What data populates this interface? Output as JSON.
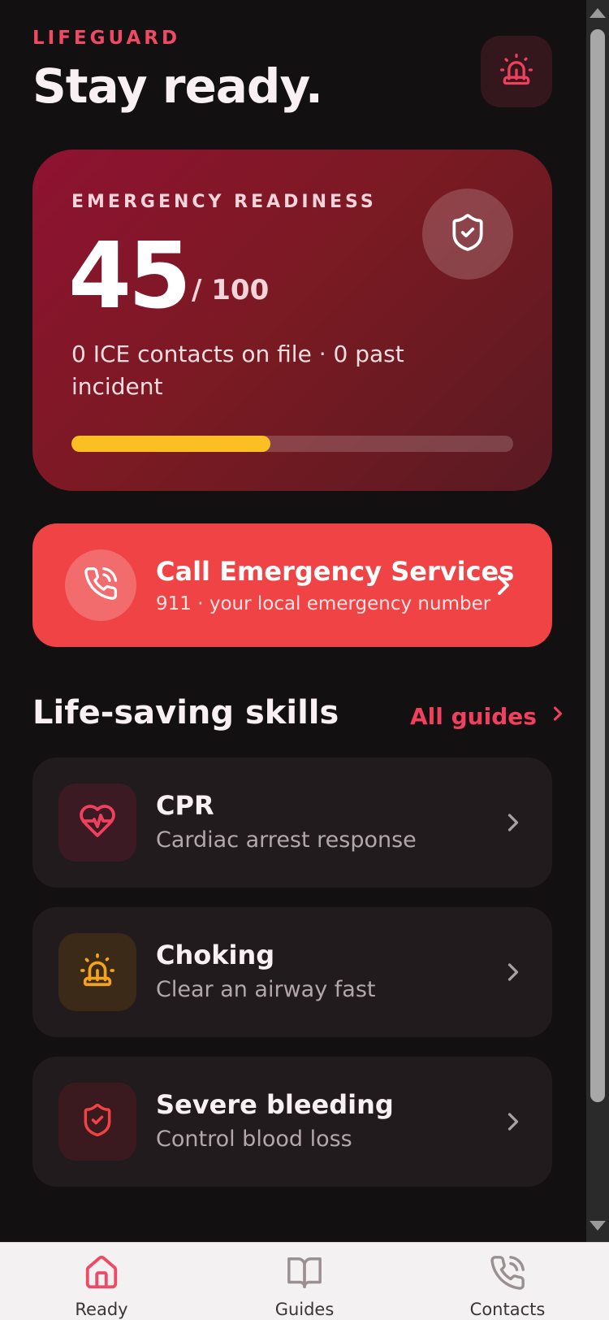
{
  "header": {
    "brand": "LIFEGUARD",
    "headline": "Stay ready.",
    "alarm_icon": "siren-icon"
  },
  "readiness": {
    "label": "EMERGENCY READINESS",
    "score": "45",
    "max": "/ 100",
    "progress_percent": 45,
    "description": "0 ICE contacts on file · 0 past incident",
    "icon": "shield-check-icon"
  },
  "call": {
    "title": "Call Emergency Services",
    "subtitle": "911 · your local emergency number",
    "icon": "phone-call-icon"
  },
  "skills_section": {
    "title": "Life-saving skills",
    "link": "All guides"
  },
  "skills": [
    {
      "title": "CPR",
      "subtitle": "Cardiac arrest response",
      "icon": "heart-pulse-icon"
    },
    {
      "title": "Choking",
      "subtitle": "Clear an airway fast",
      "icon": "siren-icon"
    },
    {
      "title": "Severe bleeding",
      "subtitle": "Control blood loss",
      "icon": "shield-check-icon"
    }
  ],
  "nav": [
    {
      "label": "Ready",
      "icon": "home-icon"
    },
    {
      "label": "Guides",
      "icon": "book-open-icon"
    },
    {
      "label": "Contacts",
      "icon": "phone-call-icon"
    }
  ],
  "colors": {
    "accent": "#ef4a64",
    "call_bg": "#ef4346",
    "progress": "#fbbf24",
    "background": "#131012",
    "skill_card": "#221b1e"
  }
}
